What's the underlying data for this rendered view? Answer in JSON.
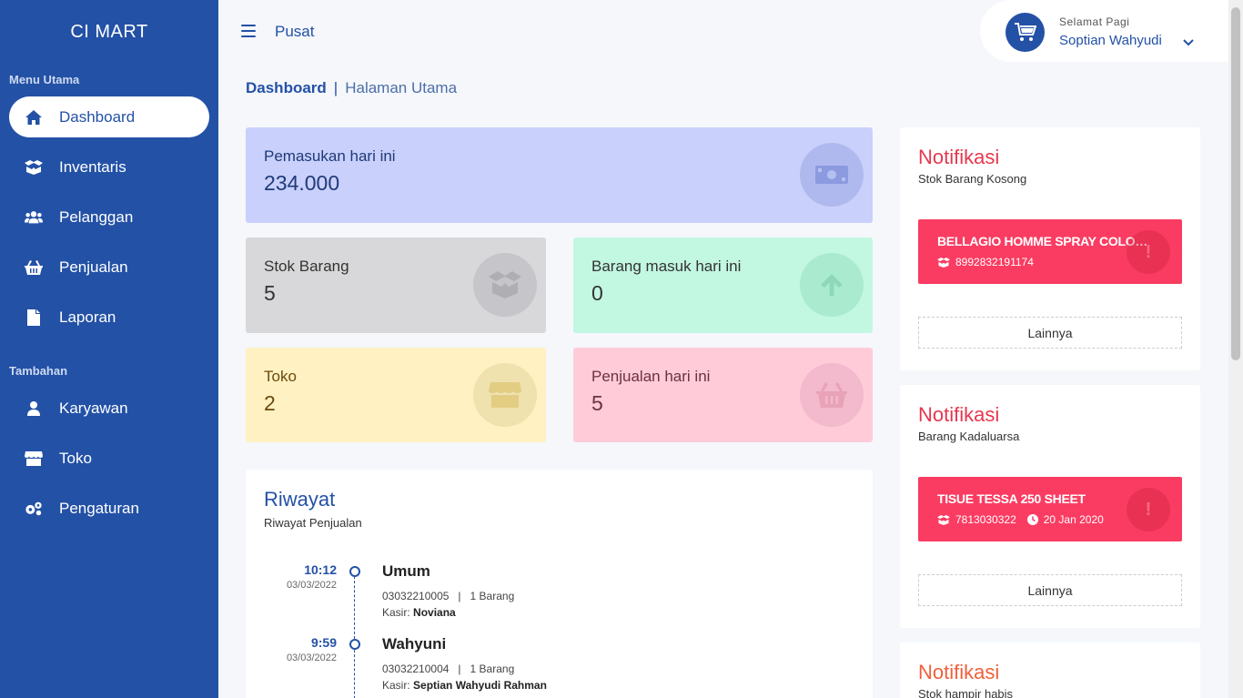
{
  "brand": "CI MART",
  "sidebar": {
    "section_main": "Menu Utama",
    "section_extra": "Tambahan",
    "items": [
      {
        "label": "Dashboard",
        "icon": "home-icon",
        "active": true
      },
      {
        "label": "Inventaris",
        "icon": "boxes-icon"
      },
      {
        "label": "Pelanggan",
        "icon": "users-icon"
      },
      {
        "label": "Penjualan",
        "icon": "basket-icon"
      },
      {
        "label": "Laporan",
        "icon": "file-icon"
      }
    ],
    "extra_items": [
      {
        "label": "Karyawan",
        "icon": "user-icon"
      },
      {
        "label": "Toko",
        "icon": "store-icon"
      },
      {
        "label": "Pengaturan",
        "icon": "cogs-icon"
      }
    ]
  },
  "topbar": {
    "title": "Pusat",
    "greeting": "Selamat Pagi",
    "user_name": "Soptian Wahyudi"
  },
  "breadcrumb": {
    "main": "Dashboard",
    "separator": "|",
    "sub": "Halaman Utama"
  },
  "stats": {
    "income": {
      "label": "Pemasukan hari ini",
      "value": "234.000",
      "icon": "money-icon"
    },
    "stock": {
      "label": "Stok Barang",
      "value": "5",
      "icon": "box-icon"
    },
    "incoming": {
      "label": "Barang masuk hari ini",
      "value": "0",
      "icon": "arrow-up-icon"
    },
    "stores": {
      "label": "Toko",
      "value": "2",
      "icon": "store-icon"
    },
    "sales": {
      "label": "Penjualan hari ini",
      "value": "5",
      "icon": "basket-icon"
    }
  },
  "history": {
    "title": "Riwayat",
    "subtitle": "Riwayat Penjualan",
    "entries": [
      {
        "time": "10:12",
        "date": "03/03/2022",
        "name": "Umum",
        "invoice": "03032210005",
        "items": "1 Barang",
        "cashier_label": "Kasir:",
        "cashier": "Noviana"
      },
      {
        "time": "9:59",
        "date": "03/03/2022",
        "name": "Wahyuni",
        "invoice": "03032210004",
        "items": "1 Barang",
        "cashier_label": "Kasir:",
        "cashier": "Septian Wahyudi Rahman"
      }
    ]
  },
  "notifications": [
    {
      "title": "Notifikasi",
      "subtitle": "Stok Barang Kosong",
      "item_name": "BELLAGIO HOMME SPRAY COLOGNE",
      "barcode": "8992832191174",
      "expiry": null,
      "more_label": "Lainnya"
    },
    {
      "title": "Notifikasi",
      "subtitle": "Barang Kadaluarsa",
      "item_name": "TISUE TESSA 250 SHEET",
      "barcode": "7813030322",
      "expiry": "20 Jan 2020",
      "more_label": "Lainnya"
    },
    {
      "title": "Notifikasi",
      "subtitle": "Stok hampir habis"
    }
  ],
  "colors": {
    "primary": "#2351a6",
    "danger": "#fa3c62",
    "income_bg": "#c9d0fb",
    "stock_bg": "#d8d8da",
    "incoming_bg": "#c2f7e2",
    "store_bg": "#fff1c1",
    "sales_bg": "#ffcbd9"
  }
}
